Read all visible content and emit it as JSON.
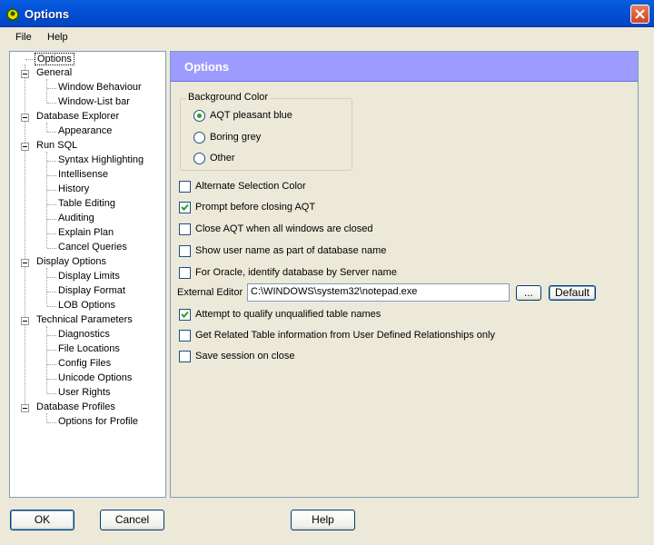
{
  "window": {
    "title": "Options"
  },
  "menu": [
    {
      "label": "File"
    },
    {
      "label": "Help"
    }
  ],
  "tree": {
    "root": "Options",
    "items": [
      {
        "label": "General"
      },
      {
        "label": "Window Behaviour"
      },
      {
        "label": "Window-List bar"
      },
      {
        "label": "Database Explorer"
      },
      {
        "label": "Appearance"
      },
      {
        "label": "Run SQL"
      },
      {
        "label": "Syntax Highlighting"
      },
      {
        "label": "Intellisense"
      },
      {
        "label": "History"
      },
      {
        "label": "Table Editing"
      },
      {
        "label": "Auditing"
      },
      {
        "label": "Explain Plan"
      },
      {
        "label": "Cancel Queries"
      },
      {
        "label": "Display Options"
      },
      {
        "label": "Display Limits"
      },
      {
        "label": "Display Format"
      },
      {
        "label": "LOB Options"
      },
      {
        "label": "Technical Parameters"
      },
      {
        "label": "Diagnostics"
      },
      {
        "label": "File Locations"
      },
      {
        "label": "Config Files"
      },
      {
        "label": "Unicode Options"
      },
      {
        "label": "User Rights"
      },
      {
        "label": "Database Profiles"
      },
      {
        "label": "Options for Profile"
      }
    ]
  },
  "panel": {
    "title": "Options",
    "background_color": {
      "label": "Background Color",
      "options": [
        {
          "label": "AQT pleasant blue",
          "selected": true
        },
        {
          "label": "Boring grey",
          "selected": false
        },
        {
          "label": "Other",
          "selected": false
        }
      ]
    },
    "checkboxes": [
      {
        "label": "Alternate Selection Color",
        "checked": false
      },
      {
        "label": "Prompt before closing AQT",
        "checked": true
      },
      {
        "label": "Close AQT when all windows are closed",
        "checked": false
      },
      {
        "label": "Show user name as part of database name",
        "checked": false
      },
      {
        "label": "For Oracle, identify database by Server name",
        "checked": false
      }
    ],
    "external_editor": {
      "label": "External Editor",
      "value": "C:\\WINDOWS\\system32\\notepad.exe",
      "browse_label": "...",
      "default_label": "Default"
    },
    "checkboxes_after": [
      {
        "label": "Attempt to qualify unqualified table names",
        "checked": true
      },
      {
        "label": "Get Related Table information from User Defined Relationships only",
        "checked": false
      },
      {
        "label": "Save session on close",
        "checked": false
      }
    ]
  },
  "buttons": {
    "ok": "OK",
    "cancel": "Cancel",
    "help": "Help"
  }
}
